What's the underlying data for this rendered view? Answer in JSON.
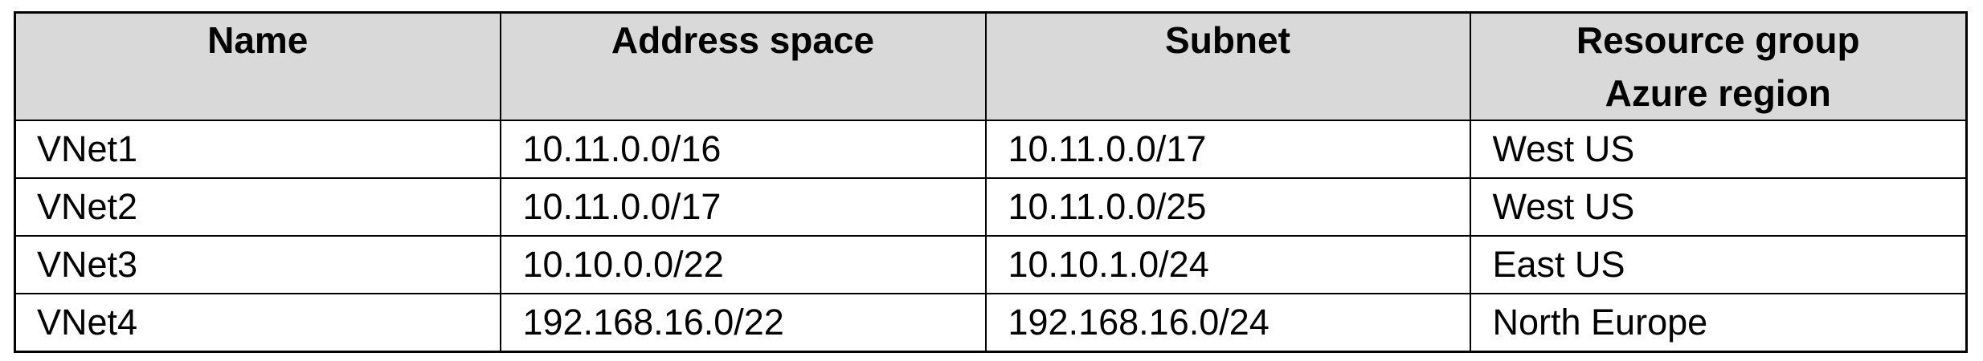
{
  "table": {
    "headers": [
      {
        "lines": [
          "Name"
        ]
      },
      {
        "lines": [
          "Address space"
        ]
      },
      {
        "lines": [
          "Subnet"
        ]
      },
      {
        "lines": [
          "Resource group",
          "Azure region"
        ]
      }
    ],
    "rows": [
      [
        "VNet1",
        "10.11.0.0/16",
        "10.11.0.0/17",
        "West US"
      ],
      [
        "VNet2",
        "10.11.0.0/17",
        "10.11.0.0/25",
        "West US"
      ],
      [
        "VNet3",
        "10.10.0.0/22",
        "10.10.1.0/24",
        "East US"
      ],
      [
        "VNet4",
        "192.168.16.0/22",
        "192.168.16.0/24",
        "North Europe"
      ]
    ]
  }
}
